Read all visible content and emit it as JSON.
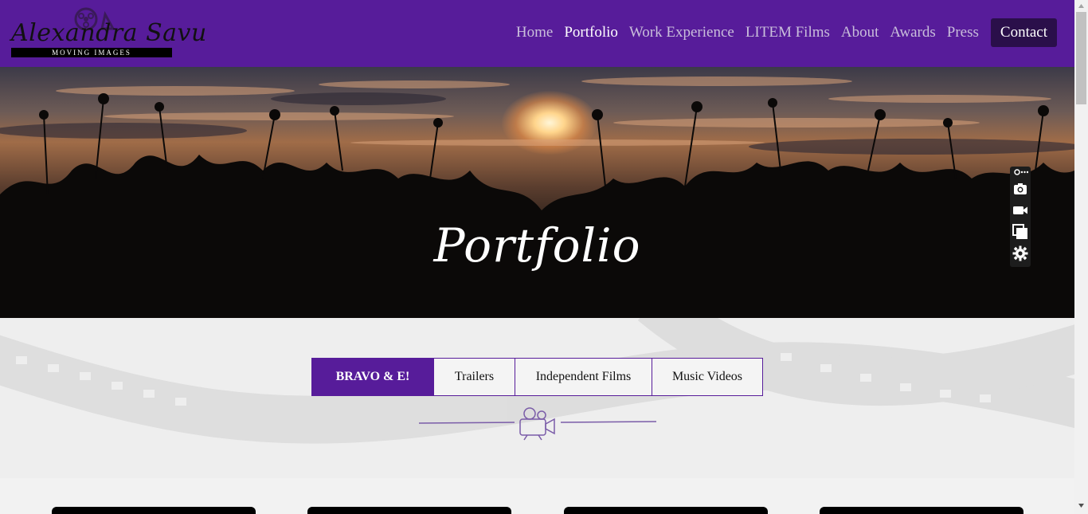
{
  "brand": {
    "name": "Alexandra Savu",
    "tagline": "MOVING   IMAGES"
  },
  "nav": {
    "items": [
      {
        "label": "Home",
        "active": false
      },
      {
        "label": "Portfolio",
        "active": true
      },
      {
        "label": "Work Experience",
        "active": false
      },
      {
        "label": "LITEM Films",
        "active": false
      },
      {
        "label": "About",
        "active": false
      },
      {
        "label": "Awards",
        "active": false
      },
      {
        "label": "Press",
        "active": false
      }
    ],
    "contact_label": "Contact"
  },
  "hero": {
    "title": "Portfolio"
  },
  "side_tools": [
    "link-more-icon",
    "camera-icon",
    "video-icon",
    "copy-icon",
    "gear-icon"
  ],
  "filters": {
    "tabs": [
      {
        "label": "BRAVO & E!",
        "active": true
      },
      {
        "label": "Trailers",
        "active": false
      },
      {
        "label": "Independent Films",
        "active": false
      },
      {
        "label": "Music Videos",
        "active": false
      }
    ]
  },
  "colors": {
    "brand_purple": "#571c9a",
    "contact_bg": "#2a0f4a",
    "nav_inactive": "#c9bedb"
  }
}
